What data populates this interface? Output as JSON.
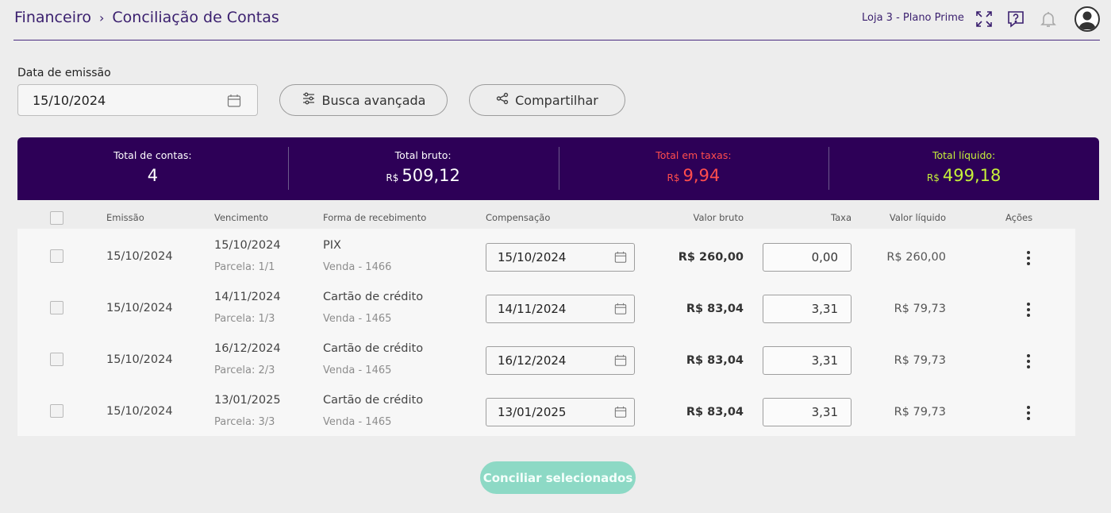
{
  "breadcrumb": {
    "section": "Financeiro",
    "separator": "›",
    "page": "Conciliação de Contas"
  },
  "header": {
    "store_label": "Loja 3 - Plano Prime"
  },
  "filters": {
    "date_label": "Data de emissão",
    "date_value": "15/10/2024",
    "advanced_search": "Busca avançada",
    "share": "Compartilhar"
  },
  "summary": {
    "total_accounts": {
      "label": "Total de contas:",
      "value": "4"
    },
    "gross": {
      "label": "Total bruto:",
      "currency": "R$",
      "value": "509,12"
    },
    "fees": {
      "label": "Total em taxas:",
      "currency": "R$",
      "value": "9,94",
      "color": "#ff4d4d"
    },
    "net": {
      "label": "Total líquido:",
      "currency": "R$",
      "value": "499,18",
      "color": "#c6f03a"
    }
  },
  "table": {
    "headers": {
      "emissao": "Emissão",
      "vencimento": "Vencimento",
      "forma": "Forma de recebimento",
      "compensacao": "Compensação",
      "bruto": "Valor bruto",
      "taxa": "Taxa",
      "liquido": "Valor líquido",
      "acoes": "Ações"
    },
    "rows": [
      {
        "emissao": "15/10/2024",
        "vencimento": "15/10/2024",
        "parcela": "Parcela: 1/1",
        "forma": "PIX",
        "venda": "Venda - 1466",
        "compensacao": "15/10/2024",
        "bruto": "R$ 260,00",
        "taxa": "0,00",
        "liquido": "R$ 260,00"
      },
      {
        "emissao": "15/10/2024",
        "vencimento": "14/11/2024",
        "parcela": "Parcela: 1/3",
        "forma": "Cartão de crédito",
        "venda": "Venda - 1465",
        "compensacao": "14/11/2024",
        "bruto": "R$ 83,04",
        "taxa": "3,31",
        "liquido": "R$ 79,73"
      },
      {
        "emissao": "15/10/2024",
        "vencimento": "16/12/2024",
        "parcela": "Parcela: 2/3",
        "forma": "Cartão de crédito",
        "venda": "Venda - 1465",
        "compensacao": "16/12/2024",
        "bruto": "R$ 83,04",
        "taxa": "3,31",
        "liquido": "R$ 79,73"
      },
      {
        "emissao": "15/10/2024",
        "vencimento": "13/01/2025",
        "parcela": "Parcela: 3/3",
        "forma": "Cartão de crédito",
        "venda": "Venda - 1465",
        "compensacao": "13/01/2025",
        "bruto": "R$ 83,04",
        "taxa": "3,31",
        "liquido": "R$ 79,73"
      }
    ]
  },
  "actions": {
    "reconcile": "Conciliar selecionados"
  },
  "colors": {
    "brand_dark": "#2d0057",
    "accent_purple": "#3a1f6e",
    "reconcile_button": "#8dd9c5"
  }
}
